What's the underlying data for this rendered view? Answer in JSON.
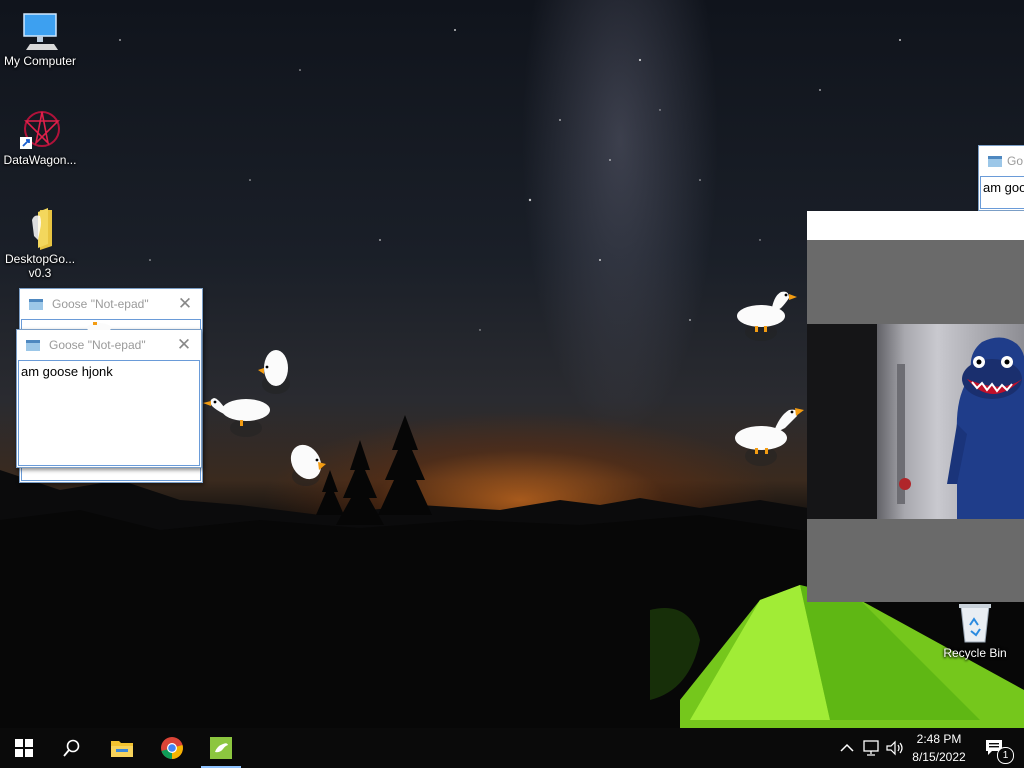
{
  "desktop": {
    "icons": [
      {
        "label": "My Computer",
        "icon": "monitor-icon"
      },
      {
        "label": "DataWagon...",
        "icon": "datawagon-icon"
      },
      {
        "label": "DesktopGo... v0.3",
        "icon": "folder-icon"
      },
      {
        "label": "Recycle Bin",
        "icon": "recycle-bin-icon"
      }
    ]
  },
  "windows": [
    {
      "title": "Goose \"Not-epad\"",
      "text": ""
    },
    {
      "title": "Goose \"Not-epad\"",
      "text": "am goose hjonk"
    },
    {
      "title": "Go",
      "text": "am goo"
    }
  ],
  "taskbar": {
    "buttons": [
      "start-icon",
      "search-icon",
      "file-explorer-icon",
      "chrome-icon",
      "desktop-goose-icon"
    ],
    "tray": [
      "chevron-up-icon",
      "network-icon",
      "volume-icon"
    ],
    "time": "2:48 PM",
    "date": "8/15/2022",
    "notification_count": "1"
  },
  "colors": {
    "taskbar": "#0a0a0a",
    "window_border": "#7b9ec6",
    "active_indicator": "#8fc3ff"
  }
}
